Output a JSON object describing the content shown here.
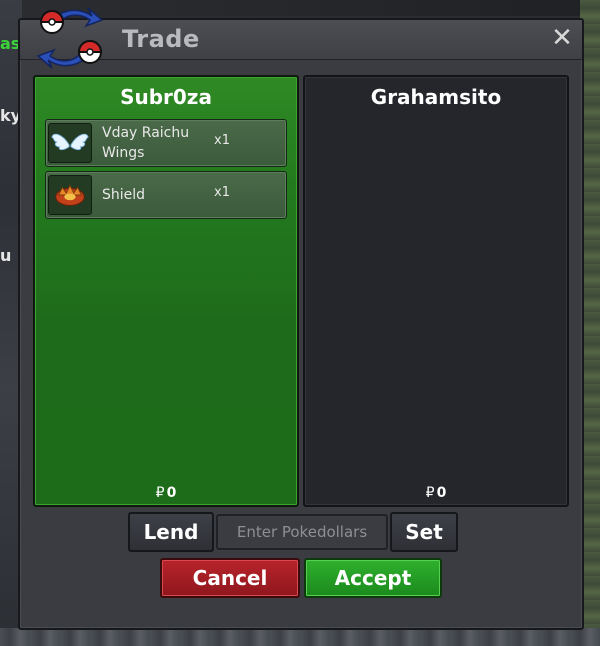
{
  "window": {
    "title": "Trade",
    "close_glyph": "✕"
  },
  "background": {
    "left_fragments": [
      "as",
      "ky",
      "u"
    ]
  },
  "trade": {
    "left": {
      "player": "Subr0za",
      "money_symbol": "₽",
      "money": "0",
      "items": [
        {
          "name": "Vday Raichu Wings",
          "qty": "x1",
          "icon": "wings-icon"
        },
        {
          "name": "Shield",
          "qty": "x1",
          "icon": "shield-item-icon"
        }
      ]
    },
    "right": {
      "player": "Grahamsito",
      "money_symbol": "₽",
      "money": "0",
      "items": []
    }
  },
  "controls": {
    "lend_label": "Lend",
    "money_placeholder": "Enter Pokedollars",
    "set_label": "Set",
    "cancel_label": "Cancel",
    "accept_label": "Accept"
  },
  "colors": {
    "left_panel": "#237a1e",
    "right_panel": "#24262b",
    "cancel": "#a81e25",
    "accept": "#26a024"
  }
}
